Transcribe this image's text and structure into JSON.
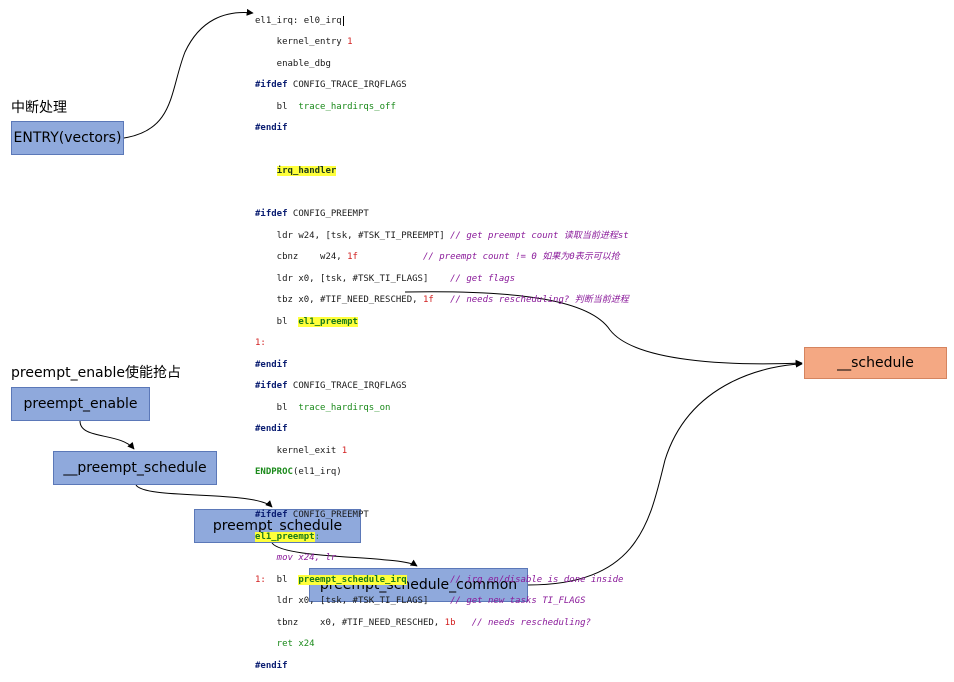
{
  "labels": {
    "interrupt_heading": "中断处理",
    "preempt_heading": "preempt_enable使能抢占"
  },
  "boxes": {
    "entry": "ENTRY(vectors)",
    "schedule": "__schedule",
    "preempt_enable": "preempt_enable",
    "__preempt_schedule": "__preempt_schedule",
    "preempt_schedule": "preempt_schedule",
    "preempt_schedule_common": "preempt_schedule_common"
  },
  "code": {
    "l01": "el1_irq: el0_irq",
    "l02a": "    kernel_entry ",
    "l02b": "1",
    "l03": "    enable_dbg",
    "l04a": "#ifdef",
    "l04b": " CONFIG_TRACE_IRQFLAGS",
    "l05a": "    bl  ",
    "l05b": "trace_hardirqs_off",
    "l06": "#endif",
    "l08": "irq_handler",
    "l10a": "#ifdef",
    "l10b": " CONFIG_PREEMPT",
    "l11a": "    ldr w24, [tsk, #TSK_TI_PREEMPT] ",
    "l11b": "// get preempt count 读取当前进程st",
    "l12a": "    cbnz    w24, ",
    "l12b": "1f",
    "l12c": "            // preempt count != 0 如果为0表示可以抢",
    "l13a": "    ldr x0, [tsk, #TSK_TI_FLAGS]    ",
    "l13b": "// get flags",
    "l14a": "    tbz x0, #TIF_NEED_RESCHED, ",
    "l14b": "1f",
    "l14c": "   // needs rescheduling? 判断当前进程",
    "l15a": "    bl  ",
    "l15b": "el1_preempt",
    "l16": "1:",
    "l17": "#endif",
    "l18a": "#ifdef",
    "l18b": " CONFIG_TRACE_IRQFLAGS",
    "l19a": "    bl  ",
    "l19b": "trace_hardirqs_on",
    "l20": "#endif",
    "l21a": "    kernel_exit ",
    "l21b": "1",
    "l22a": "ENDPROC",
    "l22b": "(el1_irq)",
    "l24a": "#ifdef",
    "l24b": " CONFIG_PREEMPT",
    "l25a": "el1_preempt",
    "l25b": ":",
    "l26": "    mov x24, lr",
    "l27a": "1:",
    "l27b": "  bl  ",
    "l27c": "preempt_schedule_irq",
    "l27d": "        // irq en/disable is done inside",
    "l28a": "    ldr x0, [tsk, #TSK_TI_FLAGS]    ",
    "l28b": "// get new tasks TI_FLAGS",
    "l29a": "    tbnz    x0, #TIF_NEED_RESCHED, ",
    "l29b": "1b",
    "l29c": "   // needs rescheduling?",
    "l30": "    ret x24",
    "l31": "#endif"
  }
}
